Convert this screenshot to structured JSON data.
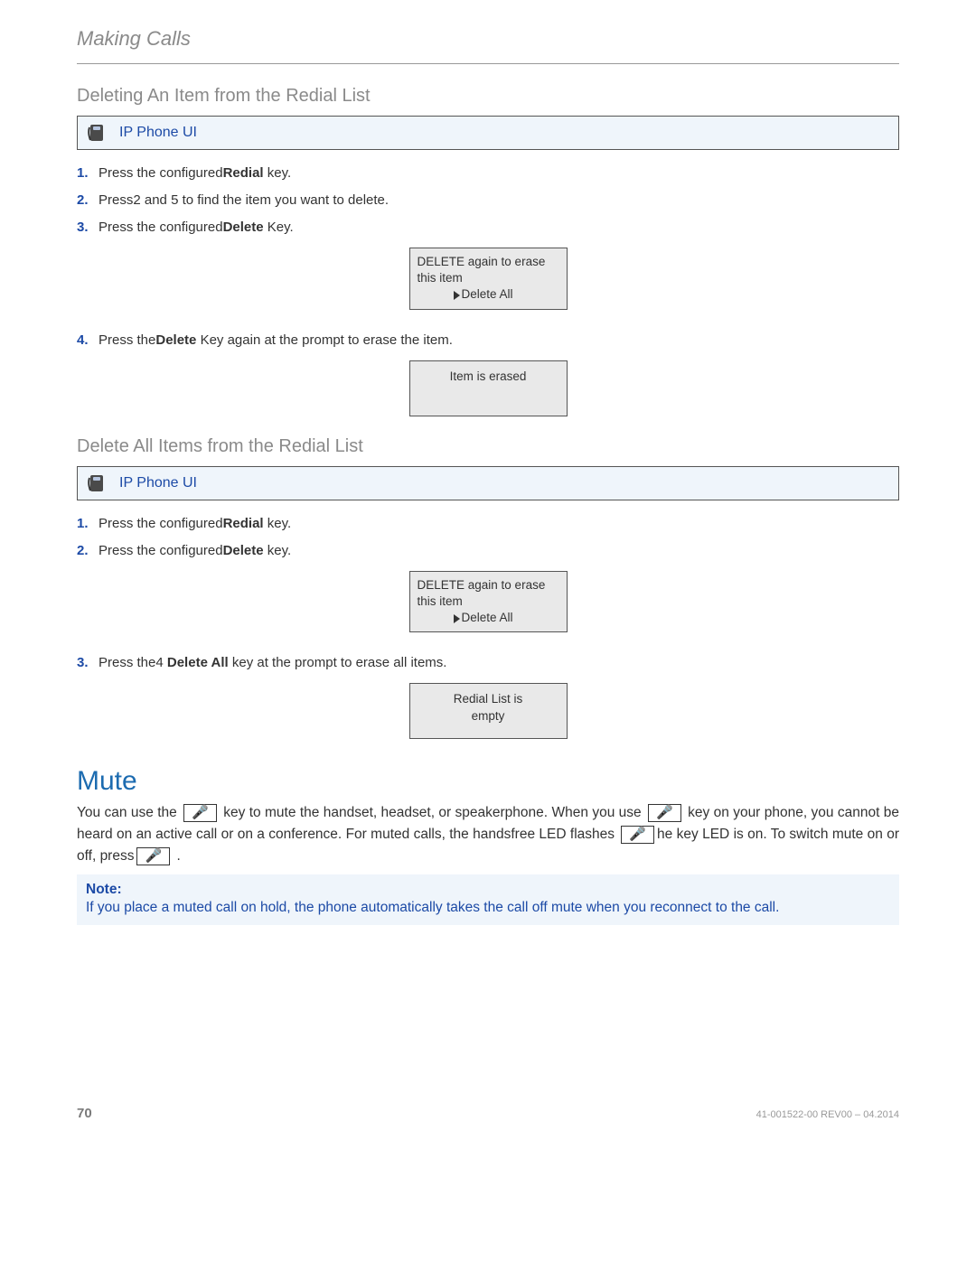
{
  "chapter_title": "Making Calls",
  "section1": {
    "heading": "Deleting An Item from the Redial List",
    "ui_box_label": "IP Phone UI",
    "steps": {
      "s1_num": "1.",
      "s1_a": "Press the configured",
      "s1_bold": "Redial",
      "s1_b": " key.",
      "s2_num": "2.",
      "s2_a": "Press",
      "s2_key1": "2",
      "s2_b": " and ",
      "s2_key2": "5",
      "s2_c": " to find the item you want to delete.",
      "s3_num": "3.",
      "s3_a": "Press the configured",
      "s3_bold": "Delete",
      "s3_b": " Key.",
      "lcd1_line1": "DELETE again to erase this item",
      "lcd1_line2": "Delete All",
      "s4_num": "4.",
      "s4_a": "Press the",
      "s4_bold": "Delete",
      "s4_b": " Key again at the prompt to erase the item.",
      "lcd2": "Item is erased"
    }
  },
  "section2": {
    "heading": "Delete All Items from the Redial List",
    "ui_box_label": "IP Phone UI",
    "steps": {
      "s1_num": "1.",
      "s1_a": "Press the configured",
      "s1_bold": "Redial",
      "s1_b": " key.",
      "s2_num": "2.",
      "s2_a": "Press the configured",
      "s2_bold": "Delete",
      "s2_b": " key.",
      "lcd1_line1": "DELETE again to erase this item",
      "lcd1_line2": "Delete All",
      "s3_num": "3.",
      "s3_a": "Press the",
      "s3_key": "4",
      "s3_bold": " Delete All",
      "s3_b": " key at the prompt to erase all items.",
      "lcd2_l1": "Redial List is",
      "lcd2_l2": "empty"
    }
  },
  "mute": {
    "heading": "Mute",
    "p_a": "You can use the ",
    "p_b": " key to mute the handset, headset, or speakerphone. When you use ",
    "p_c": " key on your phone, you cannot be heard on an active call or on a conference. For muted calls, the handsfree LED flashes ",
    "p_d": "he          key LED is on. To switch mute on or off, press",
    "p_e": " .",
    "mute_glyph": "🎤",
    "note_label": "Note:",
    "note_text": "If you place a muted call on hold, the phone automatically takes the call off mute when you reconnect to the call."
  },
  "footer": {
    "page": "70",
    "doc": "41-001522-00 REV00 – 04.2014"
  }
}
